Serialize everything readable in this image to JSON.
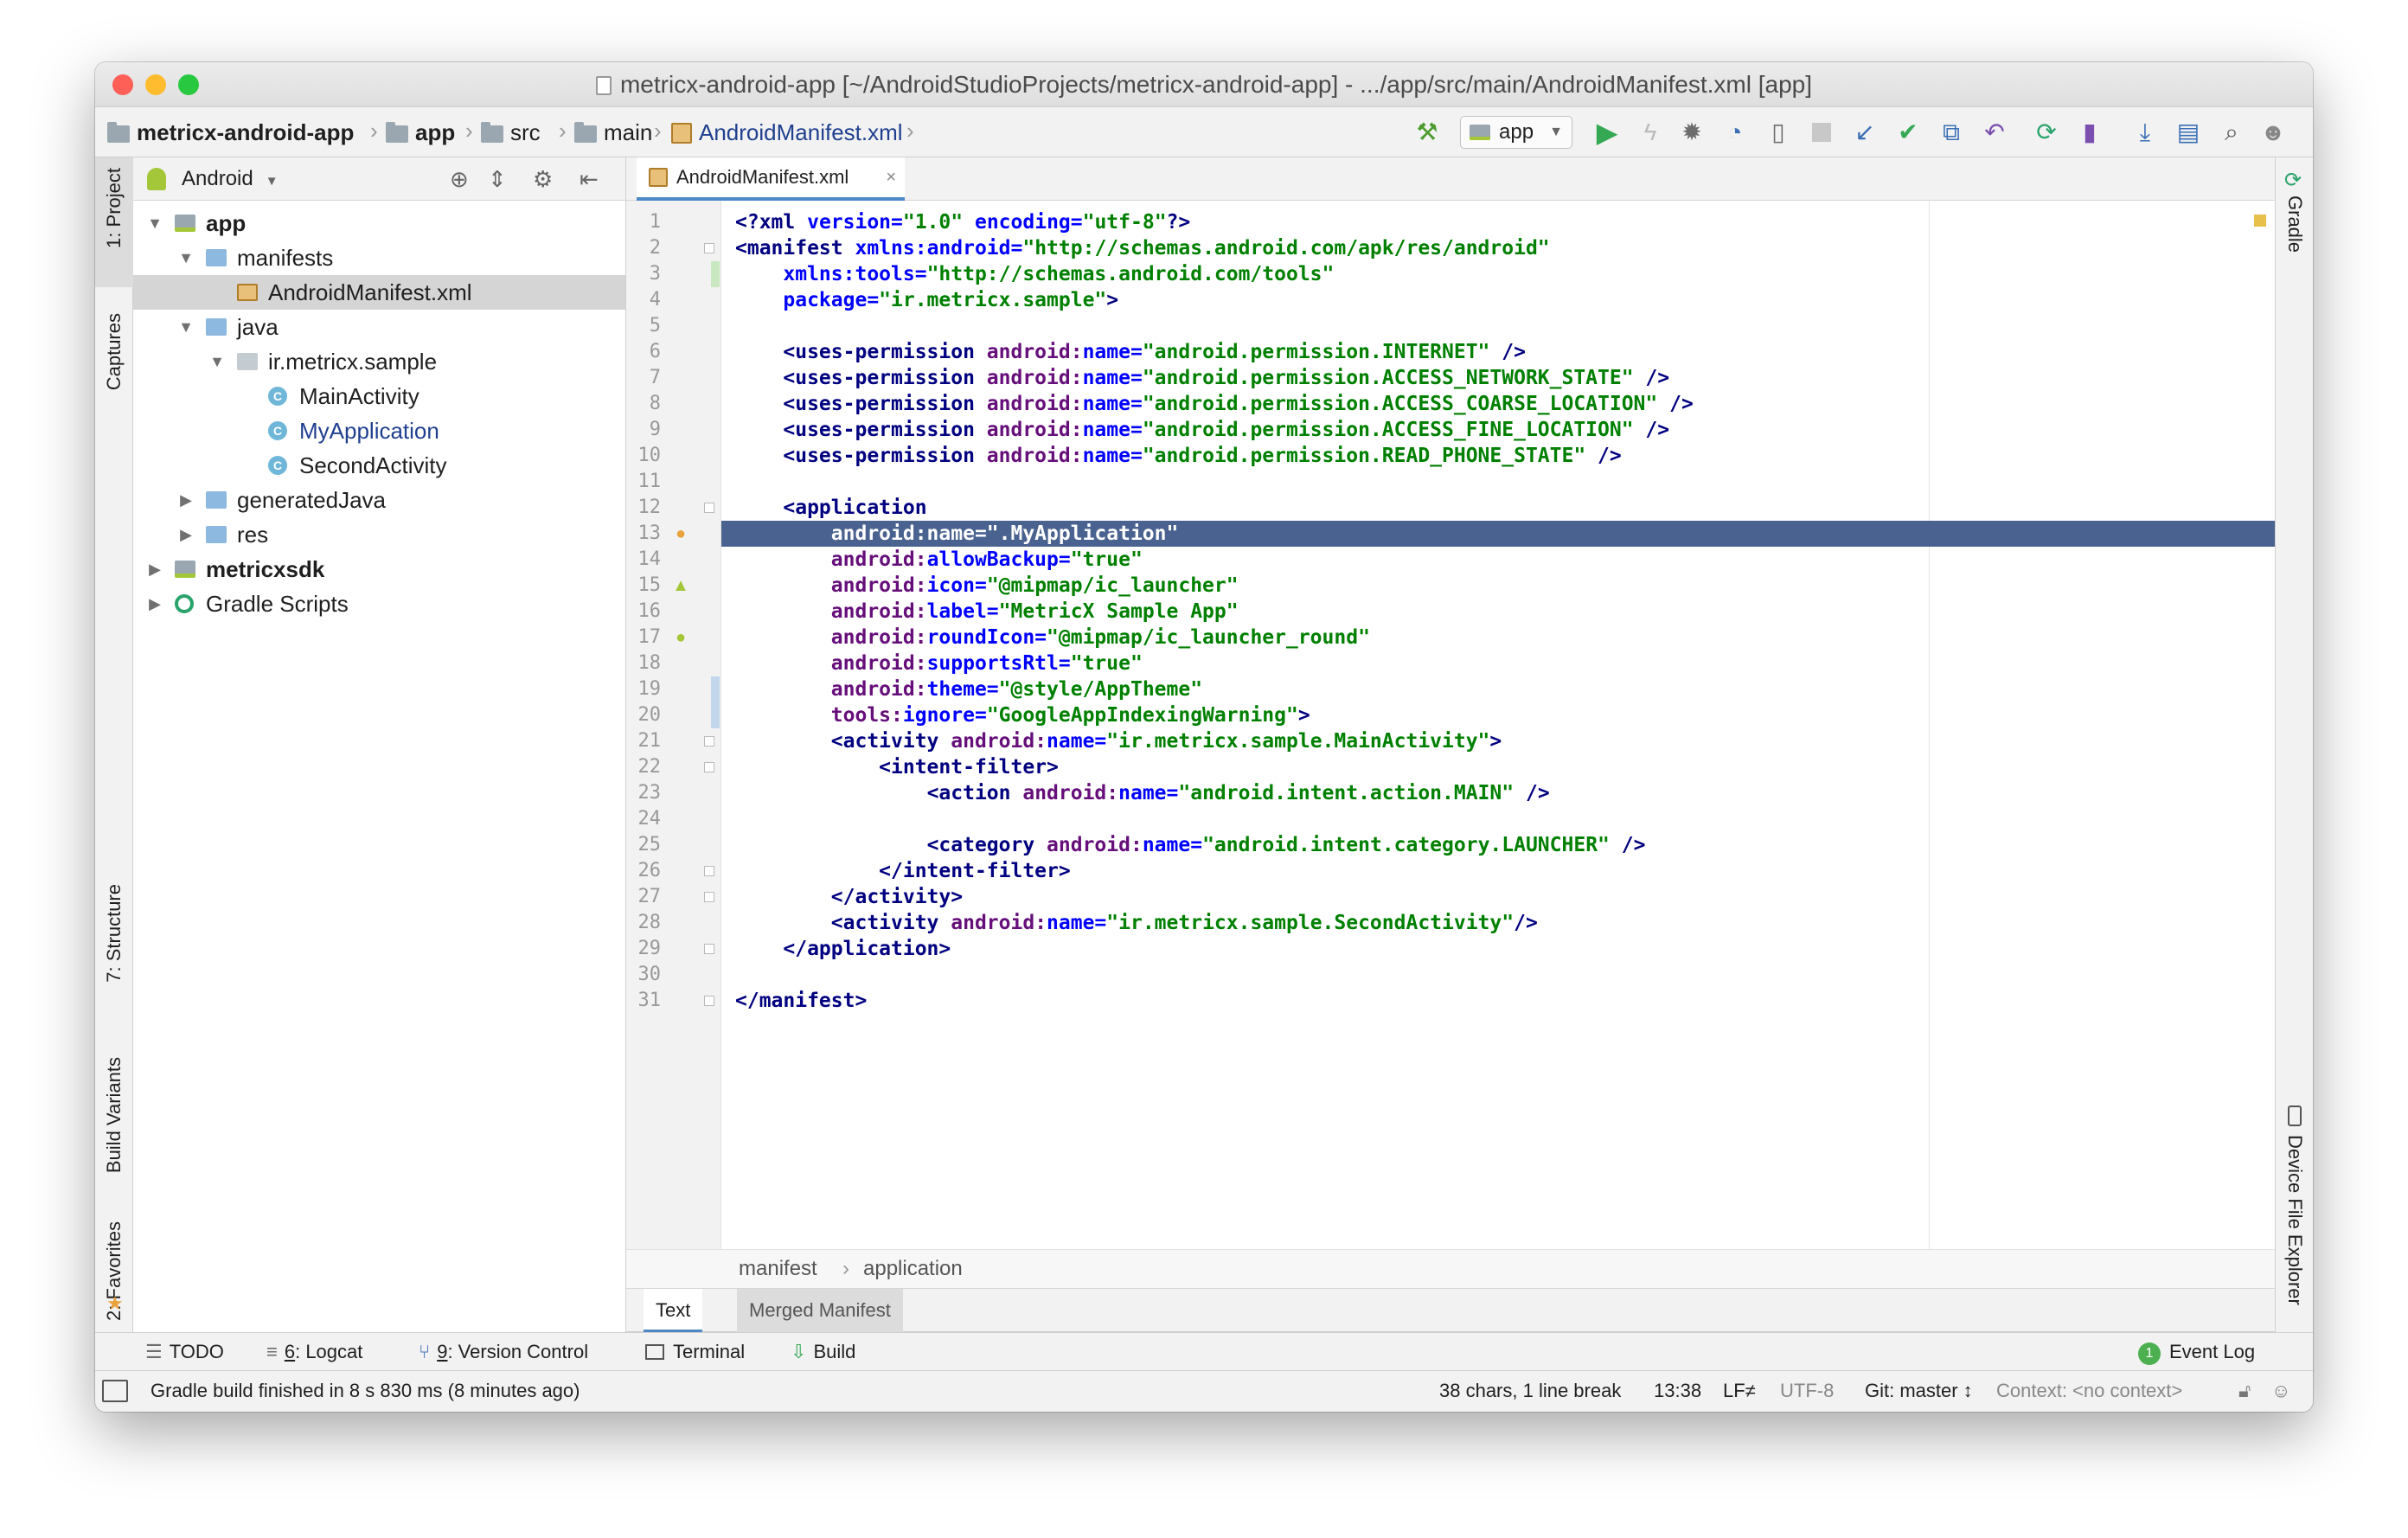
{
  "window": {
    "title": "metricx-android-app [~/AndroidStudioProjects/metricx-android-app] - .../app/src/main/AndroidManifest.xml [app]",
    "traffic_lights": {
      "close": "#fe5f57",
      "minimize": "#febc2e",
      "zoom": "#28c840"
    }
  },
  "navbar": {
    "breadcrumbs": [
      "metricx-android-app",
      "app",
      "src",
      "main",
      "AndroidManifest.xml"
    ],
    "run_config": "app",
    "toolbar_icons": [
      "hammer-icon",
      "run-icon",
      "apply-changes-icon",
      "debug-icon",
      "profile-icon",
      "attach-debugger-icon",
      "stop-icon",
      "vcs-update-icon",
      "vcs-commit-icon",
      "vcs-compare-icon",
      "vcs-revert-icon",
      "sync-gradle-icon",
      "avd-manager-icon",
      "sdk-manager-icon",
      "project-structure-icon",
      "search-icon",
      "user-icon"
    ]
  },
  "left_strip": {
    "tabs": [
      "1: Project",
      "Captures",
      "7: Structure",
      "Build Variants",
      "2: Favorites"
    ]
  },
  "right_strip": {
    "tabs": [
      "Gradle",
      "Device File Explorer"
    ]
  },
  "project_panel": {
    "view_selector": "Android",
    "tree": [
      {
        "label": "app",
        "depth": 0,
        "expanded": true,
        "bold": true,
        "icon": "module"
      },
      {
        "label": "manifests",
        "depth": 1,
        "expanded": true,
        "icon": "folder"
      },
      {
        "label": "AndroidManifest.xml",
        "depth": 2,
        "icon": "manifest",
        "selected": true
      },
      {
        "label": "java",
        "depth": 1,
        "expanded": true,
        "icon": "folder"
      },
      {
        "label": "ir.metricx.sample",
        "depth": 2,
        "expanded": true,
        "icon": "package"
      },
      {
        "label": "MainActivity",
        "depth": 3,
        "icon": "class"
      },
      {
        "label": "MyApplication",
        "depth": 3,
        "icon": "class",
        "highlight": true
      },
      {
        "label": "SecondActivity",
        "depth": 3,
        "icon": "class"
      },
      {
        "label": "generatedJava",
        "depth": 1,
        "expanded": false,
        "icon": "folder"
      },
      {
        "label": "res",
        "depth": 1,
        "expanded": false,
        "icon": "folder"
      },
      {
        "label": "metricxsdk",
        "depth": 0,
        "expanded": false,
        "bold": true,
        "icon": "module"
      },
      {
        "label": "Gradle Scripts",
        "depth": 0,
        "expanded": false,
        "icon": "gradle"
      }
    ]
  },
  "editor": {
    "tab": "AndroidManifest.xml",
    "highlighted_line": 13,
    "lines": [
      [
        [
          "t",
          "<?xml "
        ],
        [
          "a",
          "version="
        ],
        [
          "v",
          "\"1.0\""
        ],
        [
          "t",
          " "
        ],
        [
          "a",
          "encoding="
        ],
        [
          "v",
          "\"utf-8\""
        ],
        [
          "t",
          "?>"
        ]
      ],
      [
        [
          "t",
          "<manifest "
        ],
        [
          "a",
          "xmlns:android="
        ],
        [
          "v",
          "\"http://schemas.android.com/apk/res/android\""
        ]
      ],
      [
        [
          "p",
          "    "
        ],
        [
          "a",
          "xmlns:tools="
        ],
        [
          "v",
          "\"http://schemas.android.com/tools\""
        ]
      ],
      [
        [
          "p",
          "    "
        ],
        [
          "a",
          "package="
        ],
        [
          "v",
          "\"ir.metricx.sample\""
        ],
        [
          "t",
          ">"
        ]
      ],
      [],
      [
        [
          "p",
          "    "
        ],
        [
          "t",
          "<uses-permission "
        ],
        [
          "n",
          "android:"
        ],
        [
          "a",
          "name="
        ],
        [
          "v",
          "\"android.permission.INTERNET\""
        ],
        [
          "p",
          " "
        ],
        [
          "t",
          "/>"
        ]
      ],
      [
        [
          "p",
          "    "
        ],
        [
          "t",
          "<uses-permission "
        ],
        [
          "n",
          "android:"
        ],
        [
          "a",
          "name="
        ],
        [
          "v",
          "\"android.permission.ACCESS_NETWORK_STATE\""
        ],
        [
          "p",
          " "
        ],
        [
          "t",
          "/>"
        ]
      ],
      [
        [
          "p",
          "    "
        ],
        [
          "t",
          "<uses-permission "
        ],
        [
          "n",
          "android:"
        ],
        [
          "a",
          "name="
        ],
        [
          "v",
          "\"android.permission.ACCESS_COARSE_LOCATION\""
        ],
        [
          "p",
          " "
        ],
        [
          "t",
          "/>"
        ]
      ],
      [
        [
          "p",
          "    "
        ],
        [
          "t",
          "<uses-permission "
        ],
        [
          "n",
          "android:"
        ],
        [
          "a",
          "name="
        ],
        [
          "v",
          "\"android.permission.ACCESS_FINE_LOCATION\""
        ],
        [
          "p",
          " "
        ],
        [
          "t",
          "/>"
        ]
      ],
      [
        [
          "p",
          "    "
        ],
        [
          "t",
          "<uses-permission "
        ],
        [
          "n",
          "android:"
        ],
        [
          "a",
          "name="
        ],
        [
          "v",
          "\"android.permission.READ_PHONE_STATE\""
        ],
        [
          "p",
          " "
        ],
        [
          "t",
          "/>"
        ]
      ],
      [],
      [
        [
          "p",
          "    "
        ],
        [
          "t",
          "<application"
        ]
      ],
      [
        [
          "p",
          "        "
        ],
        [
          "w",
          "android:name=\".MyApplication\""
        ]
      ],
      [
        [
          "p",
          "        "
        ],
        [
          "n",
          "android:"
        ],
        [
          "a",
          "allowBackup="
        ],
        [
          "v",
          "\"true\""
        ]
      ],
      [
        [
          "p",
          "        "
        ],
        [
          "n",
          "android:"
        ],
        [
          "a",
          "icon="
        ],
        [
          "v",
          "\"@mipmap/ic_launcher\""
        ]
      ],
      [
        [
          "p",
          "        "
        ],
        [
          "n",
          "android:"
        ],
        [
          "a",
          "label="
        ],
        [
          "v",
          "\"MetricX Sample App\""
        ]
      ],
      [
        [
          "p",
          "        "
        ],
        [
          "n",
          "android:"
        ],
        [
          "a",
          "roundIcon="
        ],
        [
          "v",
          "\"@mipmap/ic_launcher_round\""
        ]
      ],
      [
        [
          "p",
          "        "
        ],
        [
          "n",
          "android:"
        ],
        [
          "a",
          "supportsRtl="
        ],
        [
          "v",
          "\"true\""
        ]
      ],
      [
        [
          "p",
          "        "
        ],
        [
          "n",
          "android:"
        ],
        [
          "a",
          "theme="
        ],
        [
          "v",
          "\"@style/AppTheme\""
        ]
      ],
      [
        [
          "p",
          "        "
        ],
        [
          "n",
          "tools:"
        ],
        [
          "a",
          "ignore="
        ],
        [
          "v",
          "\"GoogleAppIndexingWarning\""
        ],
        [
          "t",
          ">"
        ]
      ],
      [
        [
          "p",
          "        "
        ],
        [
          "t",
          "<activity "
        ],
        [
          "n",
          "android:"
        ],
        [
          "a",
          "name="
        ],
        [
          "v",
          "\"ir.metricx.sample.MainActivity\""
        ],
        [
          "t",
          ">"
        ]
      ],
      [
        [
          "p",
          "            "
        ],
        [
          "t",
          "<intent-filter>"
        ]
      ],
      [
        [
          "p",
          "                "
        ],
        [
          "t",
          "<action "
        ],
        [
          "n",
          "android:"
        ],
        [
          "a",
          "name="
        ],
        [
          "v",
          "\"android.intent.action.MAIN\""
        ],
        [
          "p",
          " "
        ],
        [
          "t",
          "/>"
        ]
      ],
      [],
      [
        [
          "p",
          "                "
        ],
        [
          "t",
          "<category "
        ],
        [
          "n",
          "android:"
        ],
        [
          "a",
          "name="
        ],
        [
          "v",
          "\"android.intent.category.LAUNCHER\""
        ],
        [
          "p",
          " "
        ],
        [
          "t",
          "/>"
        ]
      ],
      [
        [
          "p",
          "            "
        ],
        [
          "t",
          "</intent-filter>"
        ]
      ],
      [
        [
          "p",
          "        "
        ],
        [
          "t",
          "</activity>"
        ]
      ],
      [
        [
          "p",
          "        "
        ],
        [
          "t",
          "<activity "
        ],
        [
          "n",
          "android:"
        ],
        [
          "a",
          "name="
        ],
        [
          "v",
          "\"ir.metricx.sample.SecondActivity\""
        ],
        [
          "t",
          "/>"
        ]
      ],
      [
        [
          "p",
          "    "
        ],
        [
          "t",
          "</application>"
        ]
      ],
      [],
      [
        [
          "t",
          "</manifest>"
        ]
      ]
    ],
    "breadcrumb": [
      "manifest",
      "application"
    ],
    "bottom_tabs": [
      "Text",
      "Merged Manifest"
    ],
    "active_bottom_tab": "Text"
  },
  "tool_windows": {
    "left": [
      {
        "prefix": "",
        "mnemonic": "",
        "label": "TODO",
        "icon": "todo-icon"
      },
      {
        "prefix": "",
        "mnemonic": "6",
        "label": ": Logcat",
        "icon": "logcat-icon"
      },
      {
        "prefix": "",
        "mnemonic": "9",
        "label": ": Version Control",
        "icon": "version-control-icon"
      },
      {
        "prefix": "",
        "mnemonic": "",
        "label": "Terminal",
        "icon": "terminal-icon"
      },
      {
        "prefix": "",
        "mnemonic": "",
        "label": "Build",
        "icon": "build-icon"
      }
    ],
    "event_log": {
      "label": "Event Log",
      "count": "1"
    }
  },
  "status_bar": {
    "message": "Gradle build finished in 8 s 830 ms (8 minutes ago)",
    "selection": "38 chars, 1 line break",
    "position": "13:38",
    "line_separator": "LF≠",
    "encoding": "UTF-8",
    "vcs": "Git: master ↕",
    "context": "Context: <no context>"
  },
  "colors": {
    "accent": "#4a88c7",
    "line_highlight": "#4a628f",
    "android_green": "#a4c639",
    "run_green": "#34a853"
  }
}
